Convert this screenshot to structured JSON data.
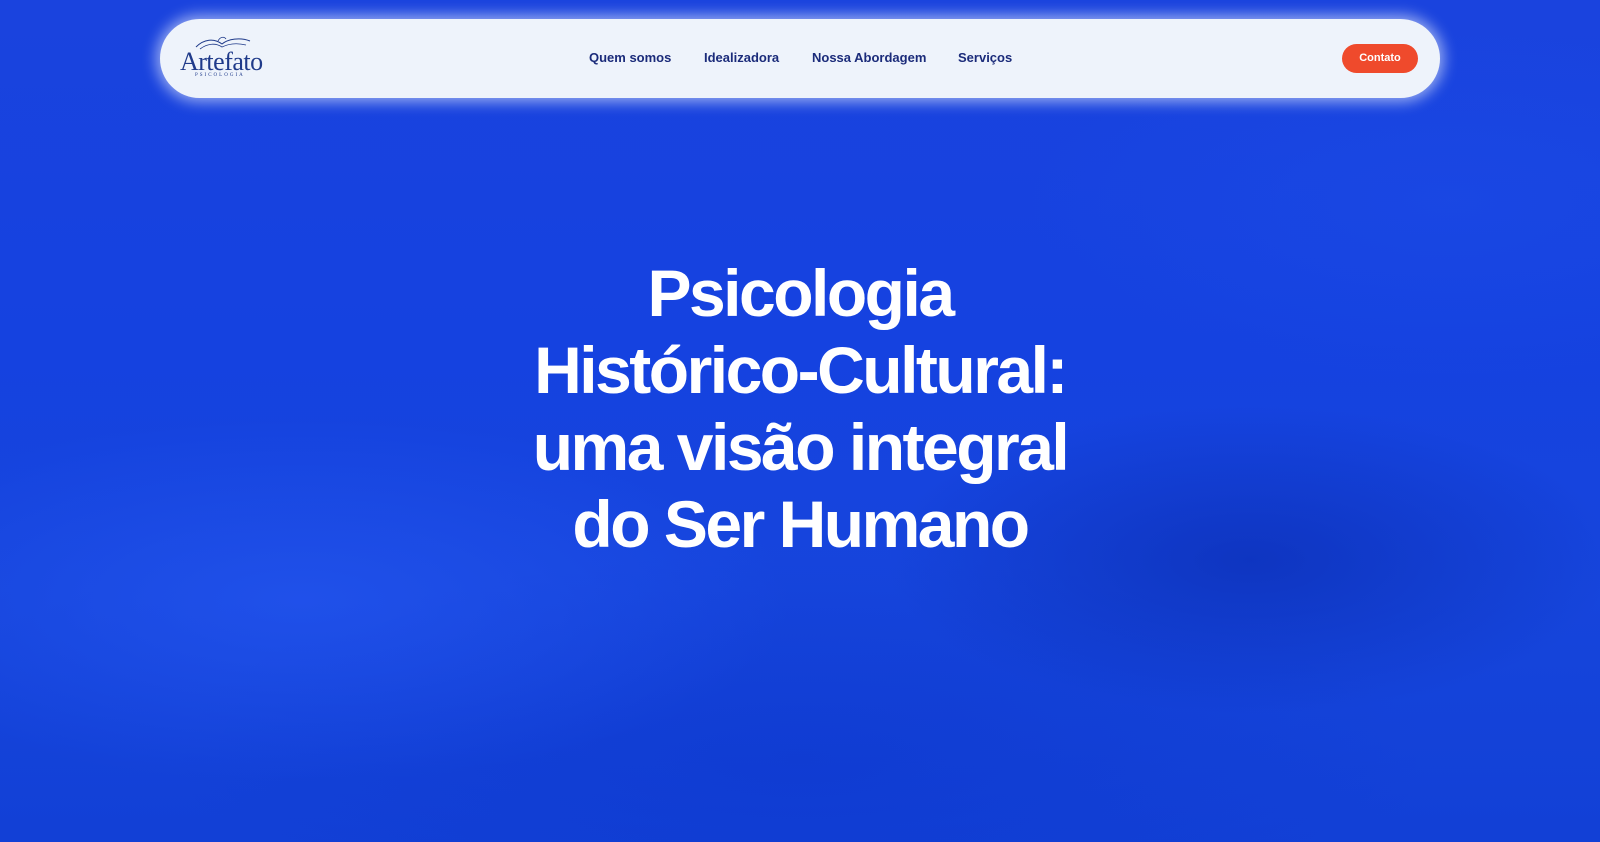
{
  "header": {
    "logo": {
      "wordmark": "Artefato",
      "subtitle": "PSICOLOGIA",
      "icon": "bird-hands-icon"
    },
    "nav": [
      {
        "label": "Quem somos"
      },
      {
        "label": "Idealizadora"
      },
      {
        "label": "Nossa Abordagem"
      },
      {
        "label": "Serviços"
      }
    ],
    "contact_label": "Contato"
  },
  "hero": {
    "title_lines": [
      "Psicologia",
      "Histórico-Cultural:",
      "uma visão integral",
      "do Ser Humano"
    ]
  },
  "colors": {
    "background": "#1a43de",
    "navbar": "#eef3fb",
    "nav_text": "#1b2b7a",
    "accent": "#ef4a2c",
    "hero_text": "#ffffff"
  }
}
